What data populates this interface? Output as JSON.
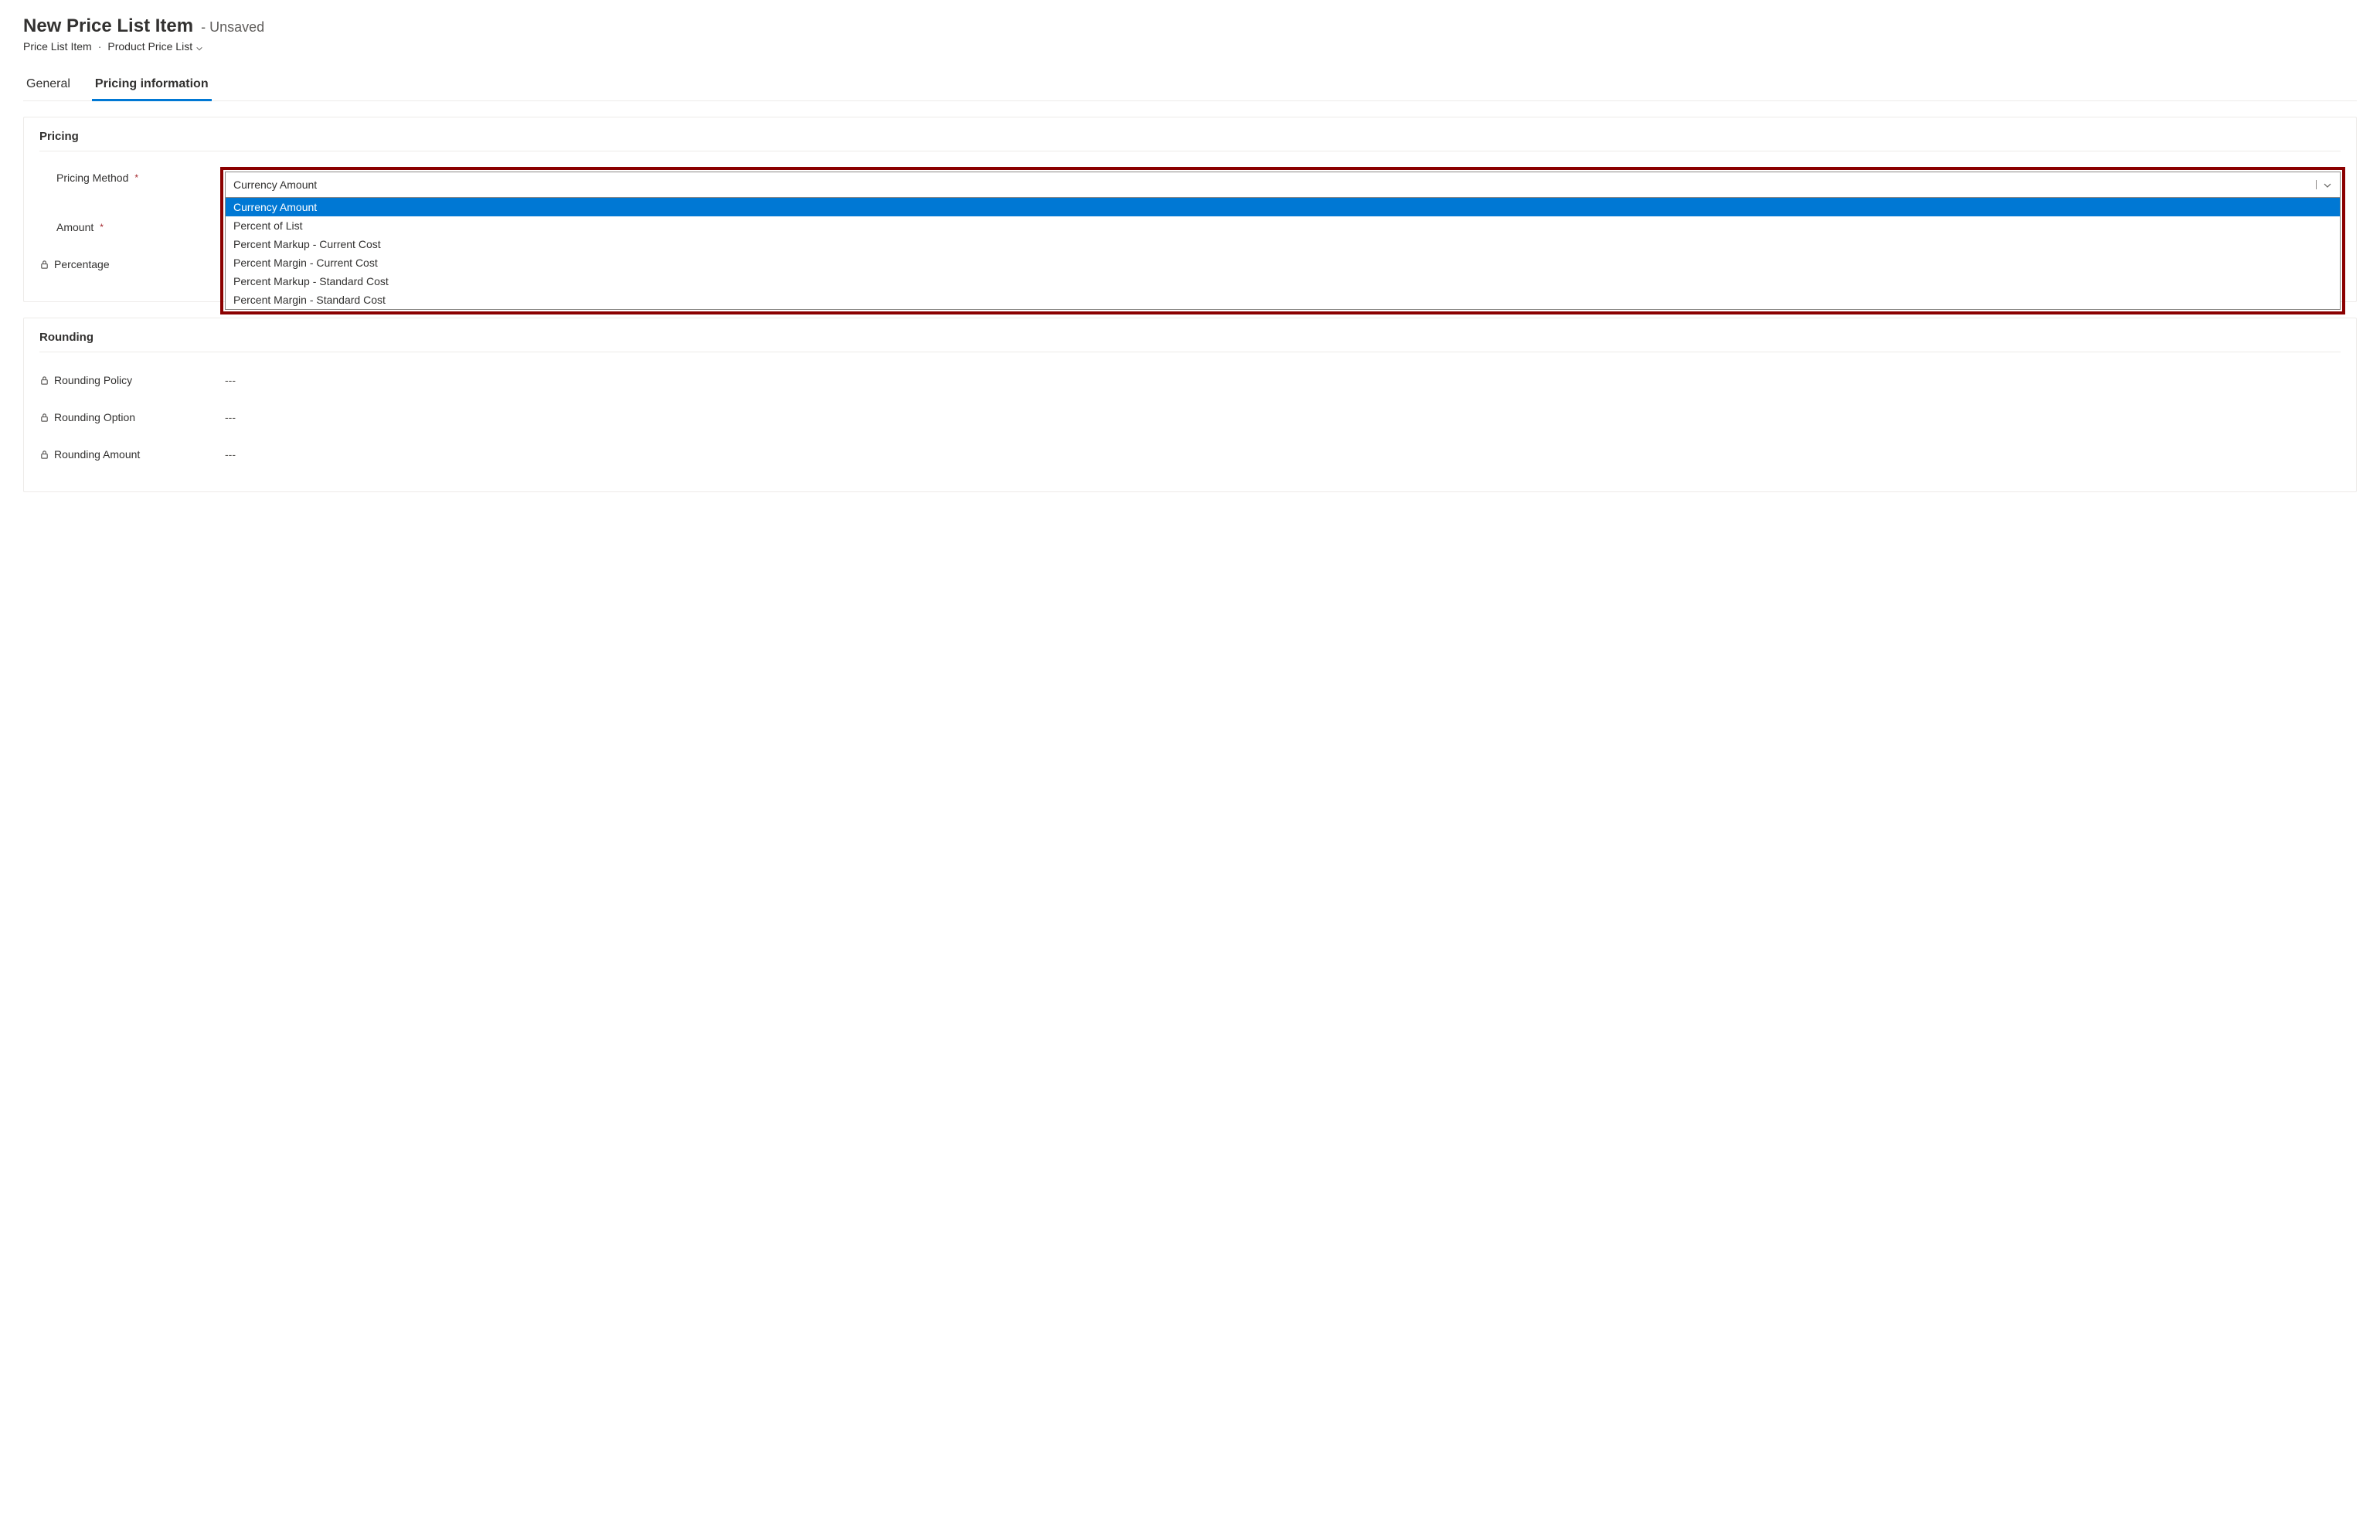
{
  "header": {
    "title": "New Price List Item",
    "unsaved_label": "- Unsaved",
    "breadcrumb": {
      "entity": "Price List Item",
      "separator": "·",
      "current": "Product Price List"
    }
  },
  "tabs": [
    {
      "id": "general",
      "label": "General",
      "active": false
    },
    {
      "id": "pricing",
      "label": "Pricing information",
      "active": true
    }
  ],
  "sections": {
    "pricing": {
      "title": "Pricing",
      "fields": {
        "pricing_method": {
          "label": "Pricing Method",
          "required": true,
          "locked": false,
          "value": "Currency Amount",
          "options": [
            "Currency Amount",
            "Percent of List",
            "Percent Markup - Current Cost",
            "Percent Margin - Current Cost",
            "Percent Markup - Standard Cost",
            "Percent Margin - Standard Cost"
          ]
        },
        "amount": {
          "label": "Amount",
          "required": true,
          "locked": false,
          "value": ""
        },
        "percentage": {
          "label": "Percentage",
          "required": false,
          "locked": true,
          "value": ""
        }
      }
    },
    "rounding": {
      "title": "Rounding",
      "fields": {
        "rounding_policy": {
          "label": "Rounding Policy",
          "locked": true,
          "value": "---"
        },
        "rounding_option": {
          "label": "Rounding Option",
          "locked": true,
          "value": "---"
        },
        "rounding_amount": {
          "label": "Rounding Amount",
          "locked": true,
          "value": "---"
        }
      }
    }
  },
  "icons": {
    "lock": "lock-icon",
    "chevron_down": "chevron-down-icon"
  }
}
